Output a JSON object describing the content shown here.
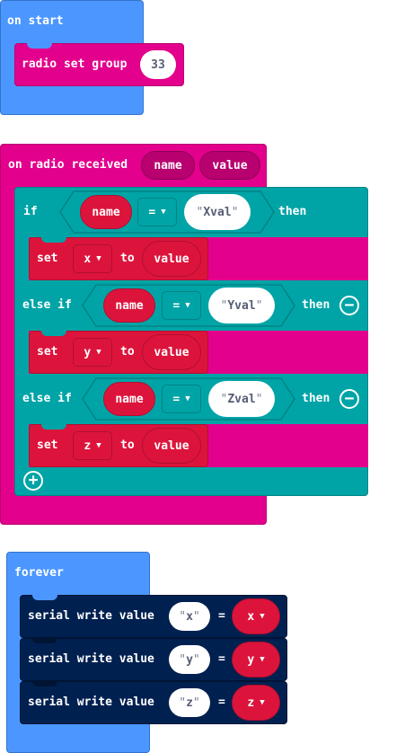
{
  "colors": {
    "basic": "#4c97ff",
    "basic_dark": "#3373cc",
    "radio": "#e3008c",
    "radio_dark": "#b8006f",
    "logic": "#00a4a6",
    "logic_dark": "#008385",
    "variables": "#dc143c",
    "variables_dark": "#b10f30",
    "serial": "#002050",
    "serial_dark": "#001433"
  },
  "on_start": {
    "label": "on start",
    "radio_set_group": {
      "label": "radio set group",
      "value": "33"
    }
  },
  "on_radio_received": {
    "label": "on radio received",
    "param_name": "name",
    "param_value": "value",
    "if_label": "if",
    "else_if_label": "else if",
    "then_label": "then",
    "eq_op": "=",
    "branches": [
      {
        "cond_left": "name",
        "cond_right": "Xval",
        "set_label": "set",
        "var": "x",
        "to_label": "to",
        "val": "value"
      },
      {
        "cond_left": "name",
        "cond_right": "Yval",
        "set_label": "set",
        "var": "y",
        "to_label": "to",
        "val": "value"
      },
      {
        "cond_left": "name",
        "cond_right": "Zval",
        "set_label": "set",
        "var": "z",
        "to_label": "to",
        "val": "value"
      }
    ],
    "add_icon": "plus-circle-icon",
    "remove_icon": "minus-circle-icon"
  },
  "forever": {
    "label": "forever",
    "rows": [
      {
        "label": "serial write value",
        "name": "x",
        "eq": "=",
        "var": "x"
      },
      {
        "label": "serial write value",
        "name": "y",
        "eq": "=",
        "var": "y"
      },
      {
        "label": "serial write value",
        "name": "z",
        "eq": "=",
        "var": "z"
      }
    ]
  },
  "icons": {
    "dropdown": "caret-down-icon"
  }
}
